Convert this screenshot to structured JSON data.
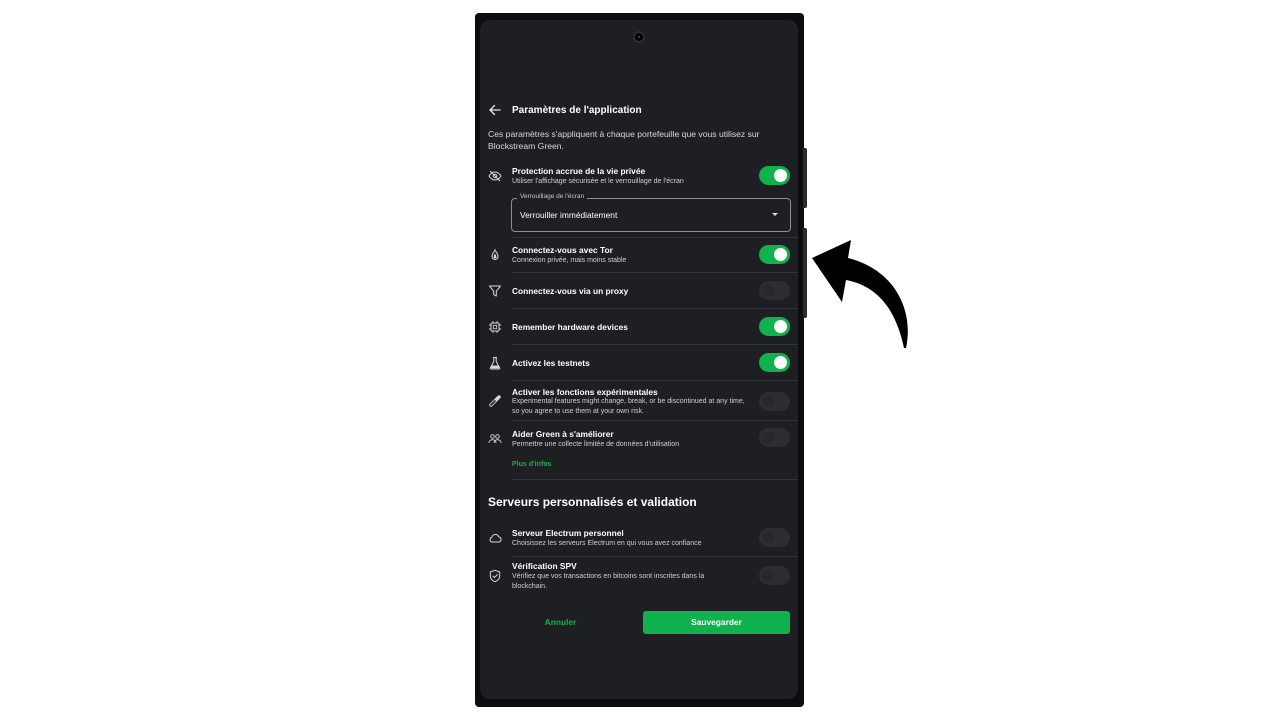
{
  "header": {
    "title": "Paramètres de l'application"
  },
  "intro": "Ces paramètres s'appliquent à chaque portefeuille que vous utilisez sur Blockstream Green.",
  "settings": [
    {
      "title": "Protection accrue de la vie privée",
      "subtitle": "Utiliser l'affichage sécurisée et le verrouillage de l'écran",
      "enabled": true,
      "icon": "eye-off-icon"
    },
    {
      "title": "Connectez-vous avec Tor",
      "subtitle": "Connexion privée, mais moins stable",
      "enabled": true,
      "icon": "onion-icon"
    },
    {
      "title": "Connectez-vous via un proxy",
      "subtitle": "",
      "enabled": false,
      "icon": "filter-icon"
    },
    {
      "title": "Remember hardware devices",
      "subtitle": "",
      "enabled": true,
      "icon": "chip-icon"
    },
    {
      "title": "Activez les testnets",
      "subtitle": "",
      "enabled": true,
      "icon": "flask-icon"
    },
    {
      "title": "Activer les fonctions expérimentales",
      "subtitle": "Experimental features might change, break, or be discontinued at any time, so you agree to use them at your own risk.",
      "enabled": false,
      "icon": "pill-icon"
    },
    {
      "title": "Aider Green à s'améliorer",
      "subtitle": "Permettre une collecte limitée de données d'utilisation",
      "enabled": false,
      "icon": "users-icon"
    }
  ],
  "screen_lock": {
    "label": "Verrouillage de l'écran",
    "value": "Verrouiller immédiatement"
  },
  "more_info": "Plus d'infos",
  "servers_section": {
    "title": "Serveurs personnalisés et validation",
    "items": [
      {
        "title": "Serveur Electrum personnel",
        "subtitle": "Choisissez les serveurs Electrum en qui vous avez confiance",
        "enabled": false,
        "icon": "cloud-icon"
      },
      {
        "title": "Vérification SPV",
        "subtitle": "Vérifiez que vos transactions en bitcoins sont inscrites dans la blockchain.",
        "enabled": false,
        "icon": "shield-check-icon"
      }
    ]
  },
  "actions": {
    "cancel": "Annuler",
    "save": "Sauvegarder"
  },
  "colors": {
    "accent": "#10b24d",
    "background": "#1d1f22"
  }
}
